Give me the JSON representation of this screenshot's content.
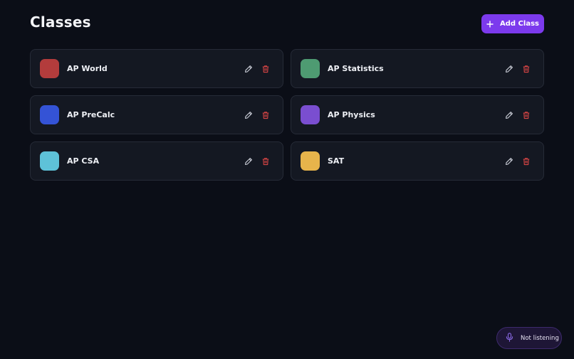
{
  "header": {
    "title": "Classes",
    "add_button_label": "Add Class"
  },
  "classes": [
    {
      "name": "AP World",
      "color": "#b33c3c"
    },
    {
      "name": "AP Statistics",
      "color": "#4e9b72"
    },
    {
      "name": "AP PreCalc",
      "color": "#3453d6"
    },
    {
      "name": "AP Physics",
      "color": "#7a4ed0"
    },
    {
      "name": "AP CSA",
      "color": "#5ec2d8"
    },
    {
      "name": "SAT",
      "color": "#e7b44b"
    }
  ],
  "icons": {
    "edit": "pencil-icon",
    "delete": "trash-icon",
    "add": "plus-icon",
    "mic": "microphone-icon"
  },
  "colors": {
    "accent": "#7c3aed",
    "delete": "#d94545",
    "background": "#0b0e17",
    "card": "#141822"
  },
  "voice": {
    "status": "Not listening"
  }
}
